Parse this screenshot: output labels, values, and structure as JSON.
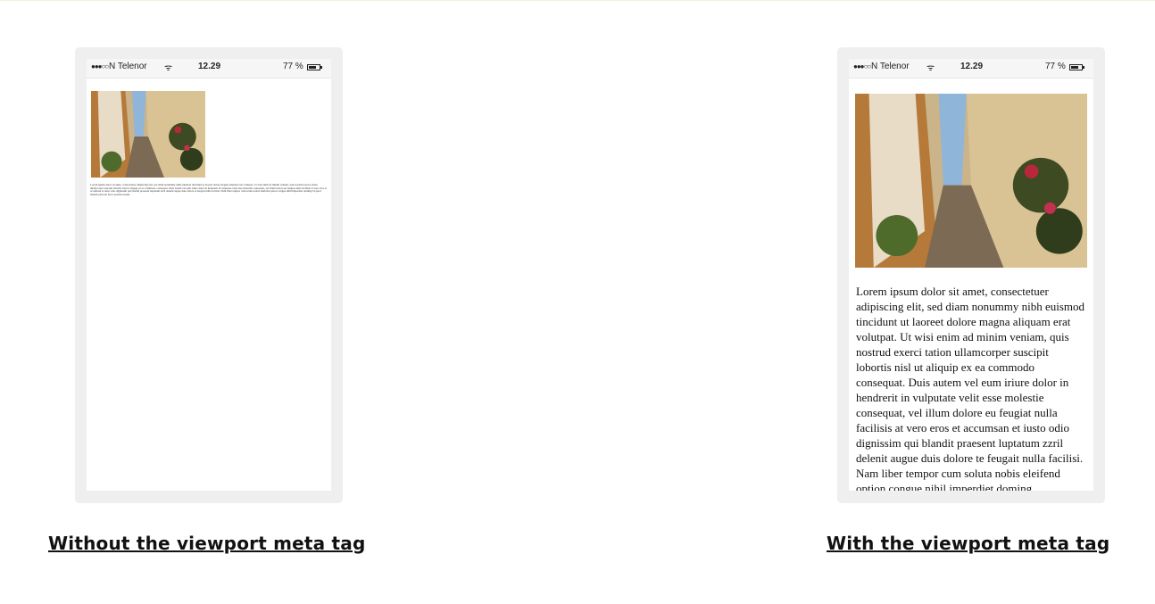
{
  "figures": {
    "left": {
      "caption": "Without the viewport meta tag",
      "status": {
        "signal": "●●●○○",
        "carrier": "N Telenor",
        "wifi": "ᯤ",
        "time": "12.29",
        "battery": "77 %"
      },
      "body_text": "Lorem ipsum dolor sit amet, consectetuer adipiscing elit, sed diam nonummy nibh euismod tincidunt ut laoreet dolore magna aliquam erat volutpat. Ut wisi enim ad minim veniam, quis nostrud exerci tation ullamcorper suscipit lobortis nisl ut aliquip ex ea commodo consequat. Duis autem vel eum iriure dolor in hendrerit in vulputate velit esse molestie consequat, vel illum dolore eu feugiat nulla facilisis at vero eros et accumsan et iusto odio dignissim qui blandit praesent luptatum zzril delenit augue duis dolore te feugait nulla facilisi. Nam liber tempor cum soluta nobis eleifend option congue nihil imperdiet doming id quod mazim placerat facer possim assum."
    },
    "right": {
      "caption": "With the viewport meta tag",
      "status": {
        "signal": "●●●○○",
        "carrier": "N Telenor",
        "wifi": "ᯤ",
        "time": "12.29",
        "battery": "77 %"
      },
      "body_text": "Lorem ipsum dolor sit amet, consectetuer adipiscing elit, sed diam nonummy nibh euismod tincidunt ut laoreet dolore magna aliquam erat volutpat. Ut wisi enim ad minim veniam, quis nostrud exerci tation ullamcorper suscipit lobortis nisl ut aliquip ex ea commodo consequat. Duis autem vel eum iriure dolor in hendrerit in vulputate velit esse molestie consequat, vel illum dolore eu feugiat nulla facilisis at vero eros et accumsan et iusto odio dignissim qui blandit praesent luptatum zzril delenit augue duis dolore te feugait nulla facilisi. Nam liber tempor cum soluta nobis eleifend option congue nihil imperdiet doming"
    }
  },
  "icons": {
    "wifi": "wifi-icon",
    "battery": "battery-icon",
    "signal": "signal-icon"
  },
  "colors": {
    "phone_frame": "#efefef",
    "caption": "#111111"
  }
}
